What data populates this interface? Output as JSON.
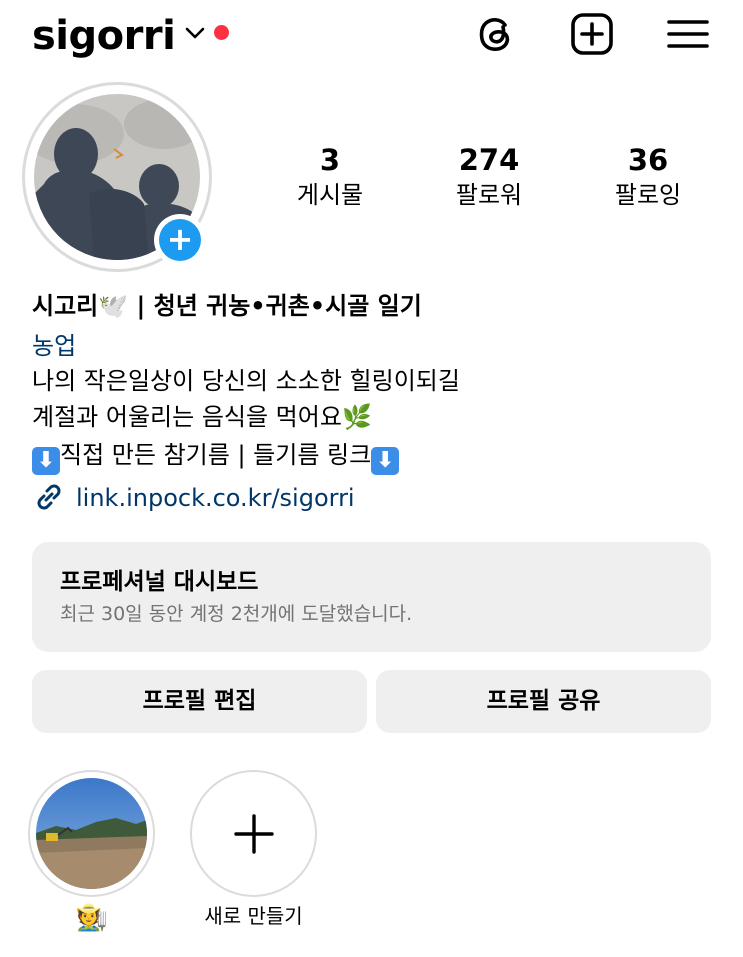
{
  "header": {
    "username": "sigorri",
    "icons": [
      "threads-icon",
      "add-post-icon",
      "menu-icon"
    ],
    "notification_color": "#ff3040"
  },
  "stats": [
    {
      "value": "3",
      "label": "게시물"
    },
    {
      "value": "274",
      "label": "팔로워"
    },
    {
      "value": "36",
      "label": "팔로잉"
    }
  ],
  "bio": {
    "name": "시고리",
    "name_emoji": "🕊️",
    "name_rest": "| 청년 귀농•귀촌•시골 일기",
    "category": "농업",
    "line1": "나의 작은일상이 당신의 소소한 힐링이되길",
    "line2": "계절과 어울리는 음식을 먹어요",
    "line2_emoji": "🌿",
    "line3": "직접 만든 참기름 | 들기름 링크",
    "line3_arrow": "⬇",
    "link": "link.inpock.co.kr/sigorri"
  },
  "dashboard": {
    "title": "프로페셔널 대시보드",
    "subtitle": "최근 30일 동안 계정 2천개에 도달했습니다."
  },
  "buttons": {
    "edit_profile": "프로필 편집",
    "share_profile": "프로필 공유"
  },
  "highlights": {
    "first_label": "🧑‍🌾",
    "new_label": "새로 만들기"
  },
  "colors": {
    "link": "#00376b",
    "accent_blue": "#1d9bf0",
    "button_bg": "#efefef"
  }
}
